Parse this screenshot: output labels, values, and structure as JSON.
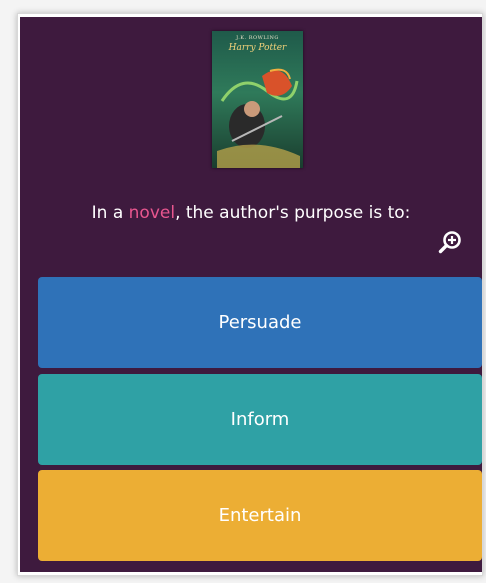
{
  "book": {
    "author": "J.K. ROWLING",
    "title": "Harry Potter"
  },
  "question": {
    "before": "In a ",
    "highlight": "novel",
    "after": ", the author's purpose is to:"
  },
  "answers": [
    {
      "label": "Persuade",
      "color": "#2f72b8"
    },
    {
      "label": "Inform",
      "color": "#2fa1a5"
    },
    {
      "label": "Entertain",
      "color": "#ecae34"
    }
  ],
  "icons": {
    "zoom": "zoom-in-icon"
  },
  "colors": {
    "background": "#3e1a3e",
    "highlight": "#e8568f"
  }
}
